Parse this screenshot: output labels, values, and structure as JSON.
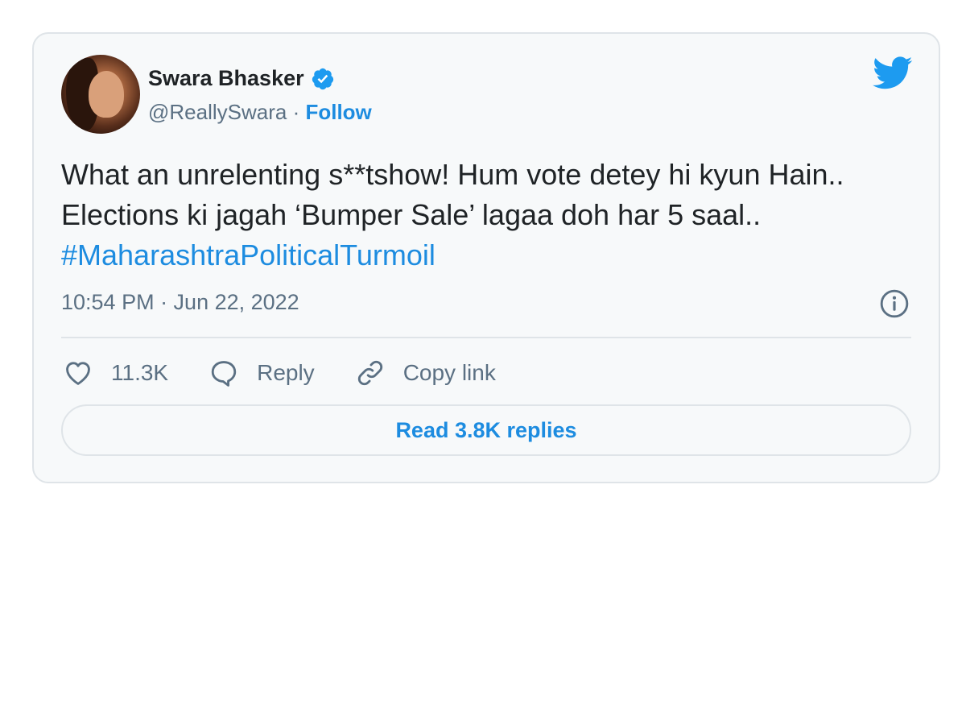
{
  "author": {
    "name": "Swara Bhasker",
    "handle": "@ReallySwara",
    "separator": " · ",
    "follow_label": "Follow",
    "avatar_icon": "avatar-photo",
    "verified_icon": "verified-badge-icon"
  },
  "tweet": {
    "text": "What an unrelenting s**tshow! Hum vote detey hi kyun Hain.. Elections ki jagah ‘Bumper Sale’ lagaa doh har 5 saal.. ",
    "hashtag": "#MaharashtraPoliticalTurmoil",
    "timestamp": "10:54 PM · Jun 22, 2022"
  },
  "actions": {
    "like_count": "11.3K",
    "reply_label": "Reply",
    "copy_link_label": "Copy link"
  },
  "footer": {
    "read_replies_label": "Read 3.8K replies"
  },
  "colors": {
    "accent": "#1d8ce0",
    "text": "#1f2326",
    "muted": "#5b7083",
    "border": "#dfe4e8",
    "card_bg": "#f7f9fa"
  },
  "icons": [
    "twitter-logo-icon",
    "verified-badge-icon",
    "info-icon",
    "heart-icon",
    "reply-bubble-icon",
    "link-icon"
  ]
}
